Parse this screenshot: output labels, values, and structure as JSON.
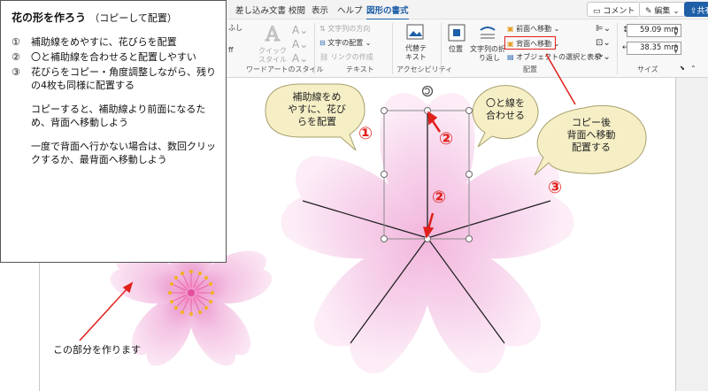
{
  "ribbon": {
    "tabs": [
      "差し込み文書",
      "校閲",
      "表示",
      "ヘルプ",
      "図形の書式"
    ],
    "active_tab": "図形の書式",
    "comment_label": "コメント",
    "edit_label": "編集",
    "share_label": "共有",
    "wordart": {
      "quick_style_line1": "クイック",
      "quick_style_line2": "スタイル",
      "group_label": "ワードアートのスタイル"
    },
    "text_group": {
      "direction": "文字列の方向",
      "align": "文字の配置",
      "link": "リンクの作成",
      "group_label": "テキスト"
    },
    "accessibility": {
      "alt_line1": "代替テ",
      "alt_line2": "キスト",
      "group_label": "アクセシビリティ"
    },
    "arrange": {
      "position": "位置",
      "wrap_line1": "文字列の折",
      "wrap_line2": "り返し",
      "bring_forward": "前面へ移動",
      "send_backward": "背面へ移動",
      "selection_pane": "オブジェクトの選択と表示",
      "group_label": "配置"
    },
    "size": {
      "height": "59.09 mm",
      "width": "38.35 mm",
      "group_label": "サイズ"
    },
    "left_fragment": "ふし",
    "left_fragment2": "ff"
  },
  "instructions": {
    "title": "花の形を作ろう",
    "title_sub": "（コピーして配置）",
    "steps": [
      {
        "num": "①",
        "text": "補助線をめやすに、花びらを配置"
      },
      {
        "num": "②",
        "text": "〇と補助線を合わせると配置しやすい"
      },
      {
        "num": "③",
        "text": "花びらをコピー・角度調整しながら、残りの4枚も同様に配置する"
      }
    ],
    "para1": "コピーすると、補助線より前面になるため、背面へ移動しよう",
    "para2": "一度で背面へ行かない場合は、数回クリックするか、最背面へ移動しよう"
  },
  "callouts": {
    "c1_line1": "補助線をめ",
    "c1_line2": "やすに、花び",
    "c1_line3": "らを配置",
    "c2_line1": "〇と線を",
    "c2_line2": "合わせる",
    "c3_line1": "コピー後",
    "c3_line2": "背面へ移動",
    "c3_line3": "配置する"
  },
  "markers": {
    "one": "①",
    "two": "②",
    "three": "③"
  },
  "note": "この部分を作ります",
  "colors": {
    "accent_blue": "#1e5fa8",
    "callout_fill": "#f6efc6",
    "marker_red": "#e0201c",
    "petal_pink": "#f4c6e6"
  }
}
